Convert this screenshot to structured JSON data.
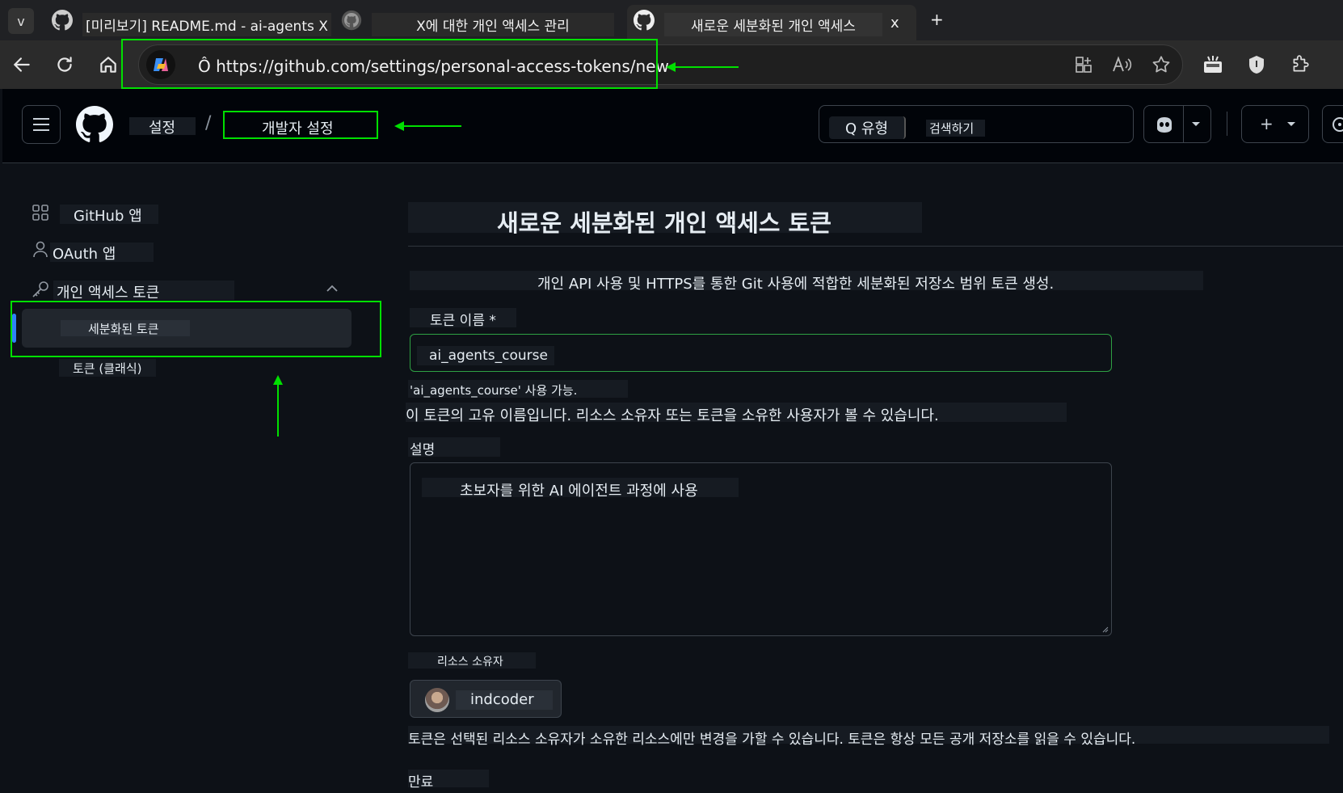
{
  "browser": {
    "tabs": [
      {
        "label": "v"
      },
      {
        "label": "[미리보기] README.md - ai-agents X"
      },
      {
        "label": "X에 대한 개인 액세스 관리"
      },
      {
        "label": "새로운 세분화된 개인 액세스",
        "close": "x",
        "active": true
      }
    ],
    "new_tab": "+",
    "url": "Ô https://github.com/settings/personal-access-tokens/new"
  },
  "header": {
    "crumb_settings": "설정",
    "crumb_sep": "/",
    "crumb_developer": "개발자 설정",
    "search_type": "Q 유형",
    "search_label": "검색하기",
    "plus": "+"
  },
  "sidebar": {
    "items": [
      {
        "label": "GitHub 앱"
      },
      {
        "label": "OAuth 앱"
      },
      {
        "label": "개인 액세스 토큰"
      },
      {
        "label": "세분화된 토큰"
      },
      {
        "label": "토큰 (클래식)"
      }
    ]
  },
  "main": {
    "title": "새로운 세분화된 개인 액세스 토큰",
    "subtitle": "개인 API 사용 및 HTTPS를 통한 Git 사용에 적합한 세분화된 저장소 범위 토큰 생성.",
    "token_name_label": "토큰 이름 *",
    "token_name_value": "ai_agents_course",
    "token_available": "'ai_agents_course' 사용 가능.",
    "token_hint": "이 토큰의 고유 이름입니다. 리소스 소유자 또는 토큰을 소유한 사용자가 볼 수 있습니다.",
    "description_label": "설명",
    "description_value": "초보자를 위한 AI 에이전트 과정에 사용",
    "resource_owner_label": "리소스 소유자",
    "resource_owner_value": "indcoder",
    "resource_owner_hint": "토큰은 선택된 리소스 소유자가 소유한 리소스에만 변경을 가할 수 있습니다. 토큰은 항상 모든 공개 저장소를 읽을 수 있습니다.",
    "expiration_label": "만료"
  },
  "colors": {
    "annotation": "#00e000",
    "accent_blue": "#2f81f7",
    "page_bg": "#0d1117"
  }
}
